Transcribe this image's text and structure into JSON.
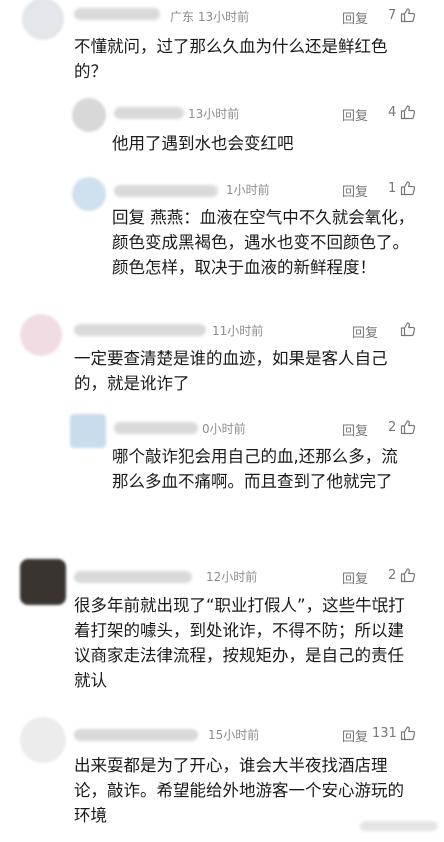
{
  "comments": [
    {
      "location_time": "广东 13小时前",
      "reply": "回复",
      "likes": "7",
      "text": "不懂就问，过了那么久血为什么还是鲜红色的？"
    },
    {
      "location_time": "13小时前",
      "reply": "回复",
      "likes": "4",
      "text": "他用了遇到水也会变红吧"
    },
    {
      "location_time": "1小时前",
      "reply": "回复",
      "likes": "1",
      "text": "回复 燕燕：血液在空气中不久就会氧化，颜色变成黑褐色，遇水也变不回颜色了。颜色怎样，取决于血液的新鲜程度！"
    },
    {
      "location_time": "11小时前",
      "reply": "回复",
      "likes": "",
      "text": "一定要查清楚是谁的血迹，如果是客人自己的，就是讹诈了"
    },
    {
      "location_time": "0小时前",
      "reply": "回复",
      "likes": "2",
      "text": "哪个敲诈犯会用自己的血,还那么多，流那么多血不痛啊。而且查到了他就完了"
    },
    {
      "location_time": "12小时前",
      "reply": "回复",
      "likes": "2",
      "text": "很多年前就出现了“职业打假人”，这些牛氓打着打架的噱头，到处讹诈，不得不防；所以建议商家走法律流程，按规矩办，是自己的责任就认"
    },
    {
      "location_time": "15小时前",
      "reply": "回复",
      "likes": "131",
      "text": "出来耍都是为了开心，谁会大半夜找酒店理论，敲诈。希望能给外地游客一个安心游玩的环境"
    }
  ]
}
